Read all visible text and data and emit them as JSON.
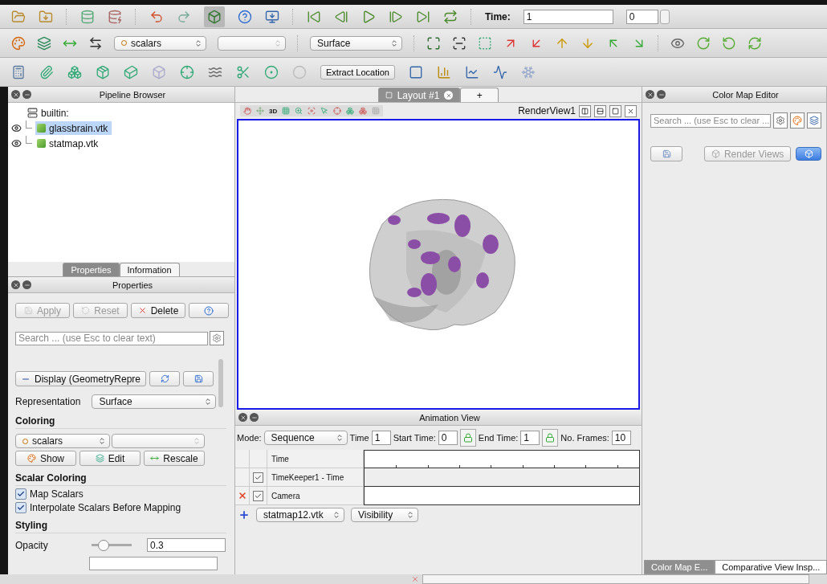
{
  "toolbar": {
    "time_label": "Time:",
    "time_value": "1",
    "time_index": "0",
    "color_by": "scalars",
    "representation": "Surface",
    "extract_label": "Extract Location"
  },
  "pipeline_browser": {
    "title": "Pipeline Browser",
    "root": "builtin:",
    "items": [
      {
        "label": "glassbrain.vtk",
        "selected": true,
        "visible": true
      },
      {
        "label": "statmap.vtk",
        "selected": false,
        "visible": true
      }
    ]
  },
  "panel_tabs": [
    {
      "label": "Properties",
      "selected": true
    },
    {
      "label": "Information",
      "selected": false
    }
  ],
  "properties": {
    "title": "Properties",
    "buttons": [
      {
        "label": "Apply",
        "kind": "apply",
        "disabled": true
      },
      {
        "label": "Reset",
        "kind": "reset",
        "disabled": true
      },
      {
        "label": "Delete",
        "kind": "delete",
        "disabled": false
      }
    ],
    "search_placeholder": "Search ... (use Esc to clear text)",
    "display_label": "Display (GeometryRepre",
    "representation_label": "Representation",
    "representation": "Surface",
    "coloring_heading": "Coloring",
    "coloring_array": "scalars",
    "coloring_buttons": [
      {
        "label": "Show",
        "kind": "show"
      },
      {
        "label": "Edit",
        "kind": "edit"
      },
      {
        "label": "Rescale",
        "kind": "rescale"
      }
    ],
    "scalar_heading": "Scalar Coloring",
    "checkboxes": [
      {
        "label": "Map Scalars",
        "checked": true
      },
      {
        "label": "Interpolate Scalars Before Mapping",
        "checked": true
      }
    ],
    "styling_heading": "Styling",
    "opacity": {
      "label": "Opacity",
      "level": 0.3,
      "value": "0.3"
    }
  },
  "layout_tabs": [
    {
      "label": "Layout #1",
      "selected": true
    }
  ],
  "new_tab": "+",
  "render_view": {
    "camera_mode": "3D",
    "title": "RenderView1"
  },
  "animation_view": {
    "title": "Animation View",
    "mode_label": "Mode:",
    "mode": "Sequence",
    "time_label": "Time",
    "time": "1",
    "start_label": "Start Time:",
    "start": "0",
    "end_label": "End Time:",
    "end": "1",
    "frames_label": "No. Frames:",
    "frames": "10",
    "tracks": [
      {
        "label": "Time",
        "kind": "header"
      },
      {
        "label": "TimeKeeper1 - Time",
        "kind": "track",
        "checked": true,
        "removable": false
      },
      {
        "label": "Camera",
        "kind": "track",
        "checked": true,
        "removable": true
      }
    ],
    "add_source": "statmap12.vtk",
    "add_property": "Visibility"
  },
  "color_map_editor": {
    "title": "Color Map Editor",
    "search_placeholder": "Search ... (use Esc to clear ...",
    "render_views": "Render Views",
    "auto_apply": true
  },
  "right_tabs": [
    {
      "label": "Color Map E...",
      "selected": true
    },
    {
      "label": "Comparative View Insp...",
      "selected": false
    }
  ]
}
